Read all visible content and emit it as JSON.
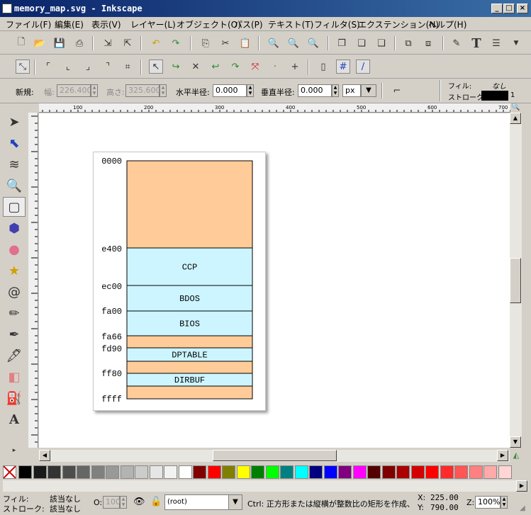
{
  "window": {
    "title": "memory_map.svg - Inkscape"
  },
  "menu": [
    "ファイル(F)",
    "編集(E)",
    "表示(V)",
    "レイヤー(L)",
    "オブジェクト(O)",
    "パス(P)",
    "テキスト(T)",
    "フィルタ(S)",
    "エクステンション(N)",
    "ヘルプ(H)"
  ],
  "props": {
    "new_label": "新規:",
    "width_label": "幅:",
    "width_value": "226.400",
    "height_label": "高さ:",
    "height_value": "325.600",
    "rx_label": "水平半径:",
    "rx_value": "0.000",
    "ry_label": "垂直半径:",
    "ry_value": "0.000",
    "unit": "px",
    "fill_label": "フィル:",
    "fill_value": "なし",
    "stroke_label": "ストローク:",
    "stroke_width": "1"
  },
  "ruler": {
    "labels": [
      "100",
      "200",
      "300",
      "400",
      "500",
      "600",
      "700"
    ]
  },
  "memory_map": {
    "labels": [
      "0000",
      "e400",
      "ec00",
      "fa00",
      "fa66",
      "fd90",
      "ff80",
      "ffff"
    ],
    "blocks": [
      {
        "name": "",
        "color": "#ffcc99"
      },
      {
        "name": "CCP",
        "color": "#ccf5ff"
      },
      {
        "name": "BDOS",
        "color": "#ccf5ff"
      },
      {
        "name": "BIOS",
        "color": "#ccf5ff"
      },
      {
        "name": "",
        "color": "#ffcc99"
      },
      {
        "name": "DPTABLE",
        "color": "#ccf5ff"
      },
      {
        "name": "",
        "color": "#ffcc99"
      },
      {
        "name": "DIRBUF",
        "color": "#ccf5ff"
      },
      {
        "name": "",
        "color": "#ffcc99"
      }
    ]
  },
  "palette": [
    "#000000",
    "#1a1a1a",
    "#333333",
    "#4d4d4d",
    "#666666",
    "#808080",
    "#999999",
    "#b3b3b3",
    "#cccccc",
    "#e6e6e6",
    "#f2f2f2",
    "#ffffff",
    "#800000",
    "#ff0000",
    "#808000",
    "#ffff00",
    "#008000",
    "#00ff00",
    "#008080",
    "#00ffff",
    "#000080",
    "#0000ff",
    "#800080",
    "#ff00ff",
    "#550000",
    "#800000",
    "#aa0000",
    "#d40000",
    "#ff0000",
    "#ff2a2a",
    "#ff5555",
    "#ff8080",
    "#ffaaaa",
    "#ffd5d5"
  ],
  "status": {
    "fill_label": "フィル:",
    "fill_value": "該当なし",
    "stroke_label": "ストローク:",
    "stroke_value": "該当なし",
    "opacity_label": "O:",
    "opacity_value": "100",
    "layer": "(root)",
    "message": "Ctrl: 正方形または縦横が整数比の矩形を作成、",
    "x_label": "X:",
    "x_value": "225.00",
    "y_label": "Y:",
    "y_value": "790.00",
    "zoom_label": "Z:",
    "zoom_value": "100%"
  }
}
